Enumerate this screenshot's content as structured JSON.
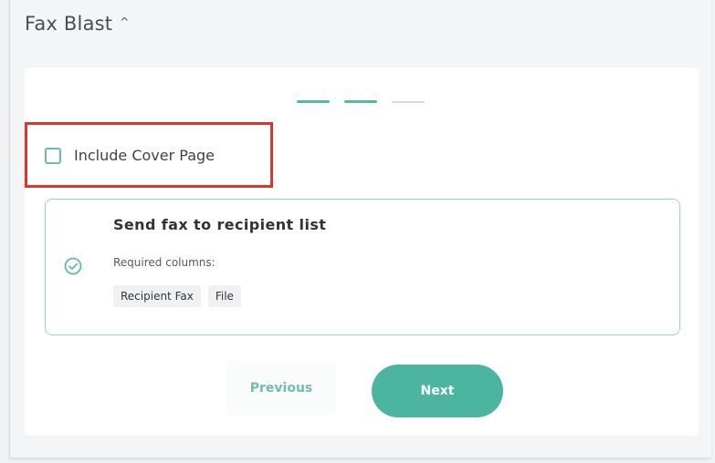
{
  "header": {
    "title": "Fax Blast",
    "caret": "^"
  },
  "stepper": {
    "completed_steps": 2,
    "total_steps": 3
  },
  "cover": {
    "label": "Include Cover Page",
    "checked": false
  },
  "option": {
    "title": "Send fax to recipient list",
    "subtitle": "Required columns:",
    "columns": [
      "Recipient Fax",
      "File"
    ]
  },
  "actions": {
    "previous_label": "Previous",
    "next_label": "Next"
  },
  "colors": {
    "accent": "#4bb59f",
    "highlight": "#d8372d"
  }
}
